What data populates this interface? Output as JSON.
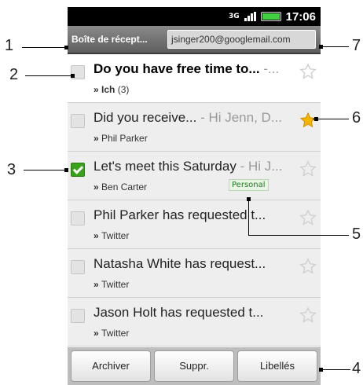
{
  "status_bar": {
    "network": "3G",
    "time": "17:06"
  },
  "header": {
    "folder": "Boîte de récept...",
    "account": "jsinger200@googlemail.com"
  },
  "messages": [
    {
      "subject": "Do you have free time to...",
      "snippet": " -...",
      "sender": "Ich",
      "count": "(3)",
      "unread": true,
      "checked": false,
      "starred": false
    },
    {
      "subject": "Did you receive...",
      "snippet": " - Hi Jenn, D...",
      "sender": "Phil Parker",
      "count": "",
      "unread": false,
      "checked": false,
      "starred": true
    },
    {
      "subject": "Let's meet this Saturday",
      "snippet": " - Hi J...",
      "sender": "Ben Carter",
      "count": "",
      "unread": false,
      "checked": true,
      "starred": false,
      "label": "Personal"
    },
    {
      "subject": "Phil Parker has requested t...",
      "snippet": "",
      "sender": "Twitter",
      "count": "",
      "unread": false,
      "checked": false,
      "starred": false
    },
    {
      "subject": "Natasha White has request...",
      "snippet": "",
      "sender": "Twitter",
      "count": "",
      "unread": false,
      "checked": false,
      "starred": false
    },
    {
      "subject": "Jason Holt has requested t...",
      "snippet": "",
      "sender": "Twitter",
      "count": "",
      "unread": false,
      "checked": false,
      "starred": false
    }
  ],
  "buttons": {
    "archive": "Archiver",
    "delete": "Suppr.",
    "labels": "Libellés"
  },
  "callouts": [
    "1",
    "2",
    "3",
    "4",
    "5",
    "6",
    "7"
  ],
  "colors": {
    "star_on": "#f5b400",
    "star_off": "#d6d6d6",
    "check": "#3aa11a"
  }
}
